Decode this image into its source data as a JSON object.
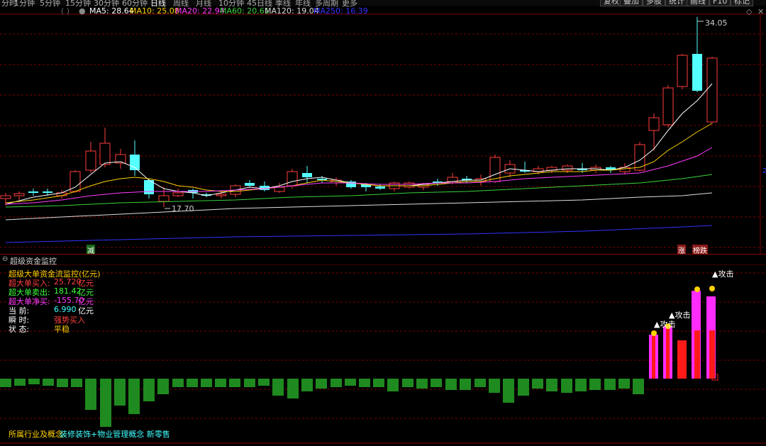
{
  "toolbar": {
    "periods": [
      "分时",
      "1分钟",
      "5分钟",
      "15分钟",
      "30分钟",
      "60分钟",
      "日线",
      "周线",
      "月线",
      "10分钟",
      "45日线",
      "季线",
      "年线",
      "多周期",
      "更多"
    ],
    "active_period": "日线",
    "right_buttons": [
      "复权",
      "叠加",
      "多股",
      "统计",
      "画线",
      "F10",
      "标记"
    ],
    "stock_name_blurred": "(  )"
  },
  "ma_legend": [
    {
      "label": "MA5: 28.64",
      "color": "#ffffff"
    },
    {
      "label": "MA10: 25.08",
      "color": "#ffd200"
    },
    {
      "label": "MA20: 22.94",
      "color": "#ff3cff"
    },
    {
      "label": "MA60: 20.61",
      "color": "#3cd23c"
    },
    {
      "label": "MA120: 19.04",
      "color": "#dcdcdc"
    },
    {
      "label": "MA250: 16.39",
      "color": "#3232ff"
    }
  ],
  "price_annotations": {
    "high": "34.05",
    "low": "17.70"
  },
  "signals": {
    "left": "减",
    "right_up": "涨",
    "right_down": "榜跌"
  },
  "right_edge_mark": "2",
  "indicator": {
    "title": "超级资金监控",
    "subtitle": "超级大单资金流监控(亿元)",
    "rows": [
      {
        "label": "超大单买入:",
        "value": "25.720",
        "unit": "亿元",
        "label_color": "#ff4040",
        "value_color": "#ff4040"
      },
      {
        "label": "超大单卖出:",
        "value": "181.42",
        "unit": "亿元",
        "label_color": "#3cff3c",
        "value_color": "#3cff3c"
      },
      {
        "label": "超大单净买:",
        "value": "-155.70",
        "unit": "亿元",
        "label_color": "#ff3cff",
        "value_color": "#ff3cff"
      },
      {
        "label": "当      前:",
        "value": "6.990",
        "unit": "亿元",
        "label_color": "#ffffff",
        "value_color": "#40ffff"
      },
      {
        "label": "瞬      时:",
        "value": "强势买入",
        "unit": "",
        "label_color": "#ffffff",
        "value_color": "#ff4040"
      },
      {
        "label": "状      态:",
        "value": "平稳",
        "unit": "",
        "label_color": "#ffffff",
        "value_color": "#ffd200"
      }
    ],
    "attack_label": "▲攻击"
  },
  "footer": {
    "label": "所属行业及概念:",
    "value": "装修装饰+物业管理概念 新零售"
  }
}
